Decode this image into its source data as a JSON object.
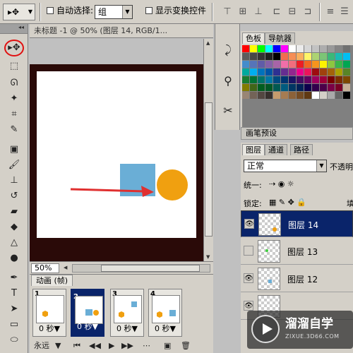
{
  "options_bar": {
    "auto_select_label": "自动选择:",
    "auto_select_value": "组",
    "show_transform_label": "显示变换控件"
  },
  "document": {
    "title": "未标题 -1 @ 50% (图层 14, RGB/1...",
    "zoom": "50%",
    "colors": {
      "frame": "#2a0a08",
      "square": "#6aaed6",
      "circle": "#f0a010",
      "arrow": "#e03030"
    }
  },
  "animation": {
    "tab_label": "动画 (帧)",
    "frames": [
      {
        "num": "1",
        "time": "0 秒▼"
      },
      {
        "num": "2",
        "time": "0 秒▼"
      },
      {
        "num": "3",
        "time": "0 秒▼"
      },
      {
        "num": "4",
        "time": "0 秒▼"
      }
    ],
    "loop": "永远"
  },
  "swatches": {
    "tabs": [
      "色板",
      "导航器"
    ],
    "colors": [
      "#ff0000",
      "#ffff00",
      "#00ff00",
      "#00ffff",
      "#0000ff",
      "#ff00ff",
      "#ffffff",
      "#ebebeb",
      "#d6d6d6",
      "#c2c2c2",
      "#adadad",
      "#999999",
      "#858585",
      "#707070",
      "#5c5c5c",
      "#474747",
      "#333333",
      "#1f1f1f",
      "#000000",
      "#f26c4f",
      "#f68e56",
      "#fbaf5d",
      "#fff568",
      "#acd372",
      "#7cc576",
      "#3bb878",
      "#1abbb4",
      "#00bff3",
      "#448ccb",
      "#5674b9",
      "#605ca8",
      "#8560a8",
      "#a864a8",
      "#f06ea9",
      "#f26d7d",
      "#ed1c24",
      "#f26522",
      "#f7941d",
      "#fff200",
      "#8dc63f",
      "#39b54a",
      "#00a651",
      "#00a99d",
      "#00aeef",
      "#0072bc",
      "#0054a6",
      "#2e3192",
      "#662d91",
      "#92278f",
      "#ec008c",
      "#ed145b",
      "#9e0b0f",
      "#a0410d",
      "#a3620a",
      "#aba000",
      "#598527",
      "#197b30",
      "#007236",
      "#00746b",
      "#0076a3",
      "#004a80",
      "#003471",
      "#1b1464",
      "#440e62",
      "#630460",
      "#9e005d",
      "#9e0039",
      "#790000",
      "#7b2e00",
      "#7d4900",
      "#827b00",
      "#406618",
      "#005e20",
      "#005826",
      "#005952",
      "#005b7f",
      "#003663",
      "#002157",
      "#0d004c",
      "#32004b",
      "#4b0049",
      "#7b0046",
      "#7a0026",
      "#c7b299",
      "#998675",
      "#736357",
      "#534741",
      "#37302d",
      "#c69c6d",
      "#a67c52",
      "#8c6239",
      "#754c24",
      "#603913",
      "#ffffff",
      "#d4d0c8",
      "#aaaaaa",
      "#666666",
      "#000000"
    ]
  },
  "brush_preset_label": "画笔预设",
  "layers": {
    "tabs": [
      "图层",
      "通道",
      "路径"
    ],
    "blend_mode": "正常",
    "opacity_label": "不透明",
    "unify_label": "统一:",
    "lock_label": "锁定:",
    "fill_label": "填",
    "items": [
      {
        "name": "图层 14",
        "visible": "👁"
      },
      {
        "name": "图层 13",
        "visible": ""
      },
      {
        "name": "图层 12",
        "visible": "👁"
      },
      {
        "name": "",
        "visible": "👁"
      }
    ]
  },
  "watermark": {
    "title": "溜溜自学",
    "url": "ZIXUE.3D66.COM"
  }
}
